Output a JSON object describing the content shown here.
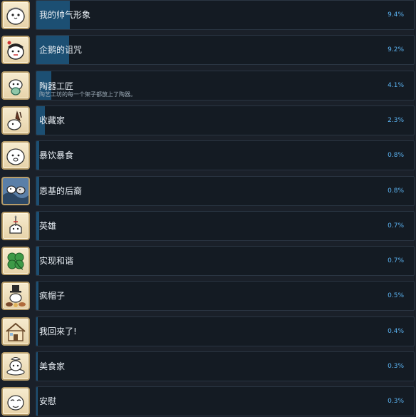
{
  "achievements": [
    {
      "title": "我的帅气形象",
      "percent": "9.4%",
      "fill": 0.094,
      "description": "",
      "icon": "chubby-bird-portrait-icon"
    },
    {
      "title": "企鹅的诅咒",
      "percent": "9.2%",
      "fill": 0.092,
      "description": "",
      "icon": "penguin-curse-icon"
    },
    {
      "title": "陶器工匠",
      "percent": "4.1%",
      "fill": 0.041,
      "description": "陶艺工坊的每一个架子都放上了陶器。",
      "icon": "pottery-icon"
    },
    {
      "title": "收藏家",
      "percent": "2.3%",
      "fill": 0.023,
      "description": "",
      "icon": "collector-icon"
    },
    {
      "title": "暴饮暴食",
      "percent": "0.8%",
      "fill": 0.008,
      "description": "",
      "icon": "gluttony-icon"
    },
    {
      "title": "恩基的后裔",
      "percent": "0.8%",
      "fill": 0.008,
      "description": "",
      "icon": "enki-descendant-icon"
    },
    {
      "title": "英雄",
      "percent": "0.7%",
      "fill": 0.007,
      "description": "",
      "icon": "hero-icon"
    },
    {
      "title": "实现和谐",
      "percent": "0.7%",
      "fill": 0.007,
      "description": "",
      "icon": "four-leaf-clover-icon"
    },
    {
      "title": "疯帽子",
      "percent": "0.5%",
      "fill": 0.005,
      "description": "",
      "icon": "mad-hatter-icon"
    },
    {
      "title": "我回来了!",
      "percent": "0.4%",
      "fill": 0.004,
      "description": "",
      "icon": "house-icon"
    },
    {
      "title": "美食家",
      "percent": "0.3%",
      "fill": 0.003,
      "description": "",
      "icon": "gourmet-icon"
    },
    {
      "title": "安慰",
      "percent": "0.3%",
      "fill": 0.003,
      "description": "",
      "icon": "comfort-icon"
    }
  ],
  "colors": {
    "background": "#1a2029",
    "panel": "#141b23",
    "bar": "#1c4f73",
    "percent_text": "#5bb2f0",
    "title_text": "#e7edf3",
    "icon_frame": "#b79d6a"
  }
}
